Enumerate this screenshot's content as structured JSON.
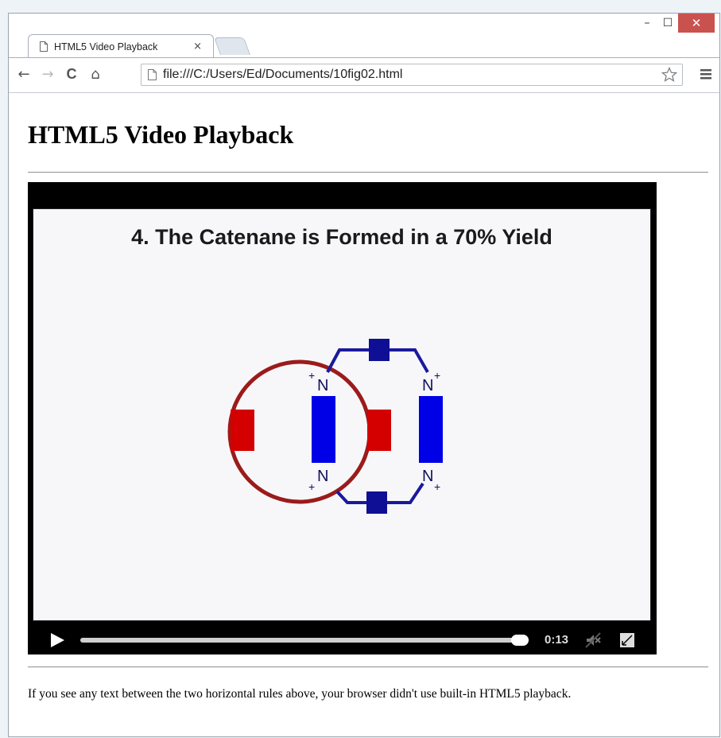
{
  "window": {
    "controls": {
      "minimize": "–",
      "maximize": "☐",
      "close": "✕"
    }
  },
  "tab": {
    "title": "HTML5 Video Playback",
    "close": "×"
  },
  "toolbar": {
    "back": "←",
    "forward": "→",
    "reload": "C",
    "home": "⌂",
    "url": "file:///C:/Users/Ed/Documents/10fig02.html"
  },
  "page": {
    "heading": "HTML5 Video Playback",
    "note": "If you see any text between the two horizontal rules above, your browser didn't use built-in HTML5 playback."
  },
  "video": {
    "slide_title": "4. The Catenane is Formed in a 70% Yield",
    "diagram_labels": {
      "n_top_left": "N",
      "n_top_right": "N",
      "n_bottom_left": "N",
      "n_bottom_right": "N",
      "plus": "+"
    },
    "time": "0:13",
    "progress": 1.0,
    "colors": {
      "red": "#d40000",
      "blue": "#0000e6",
      "ring": "#9b1b1b",
      "linker": "#1a1a9c"
    }
  }
}
